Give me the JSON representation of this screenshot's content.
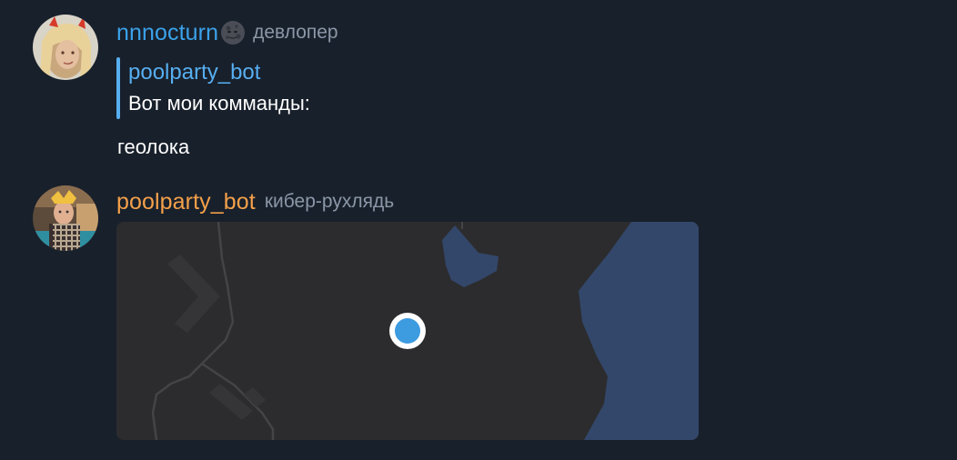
{
  "messages": [
    {
      "author": "nnnocturn",
      "author_color": "#3ba2ea",
      "emoji": "new-moon-face-emoji",
      "role": "девлопер",
      "reply": {
        "author": "poolparty_bot",
        "text": "Вот мои комманды:"
      },
      "text": "геолока"
    },
    {
      "author": "poolparty_bot",
      "author_color": "#f5a04a",
      "role": "кибер-рухлядь",
      "attachment": {
        "type": "location-map",
        "marker_color": "#3d9be0",
        "water_color": "#33476a",
        "land_color": "#2c2c2e"
      }
    }
  ]
}
